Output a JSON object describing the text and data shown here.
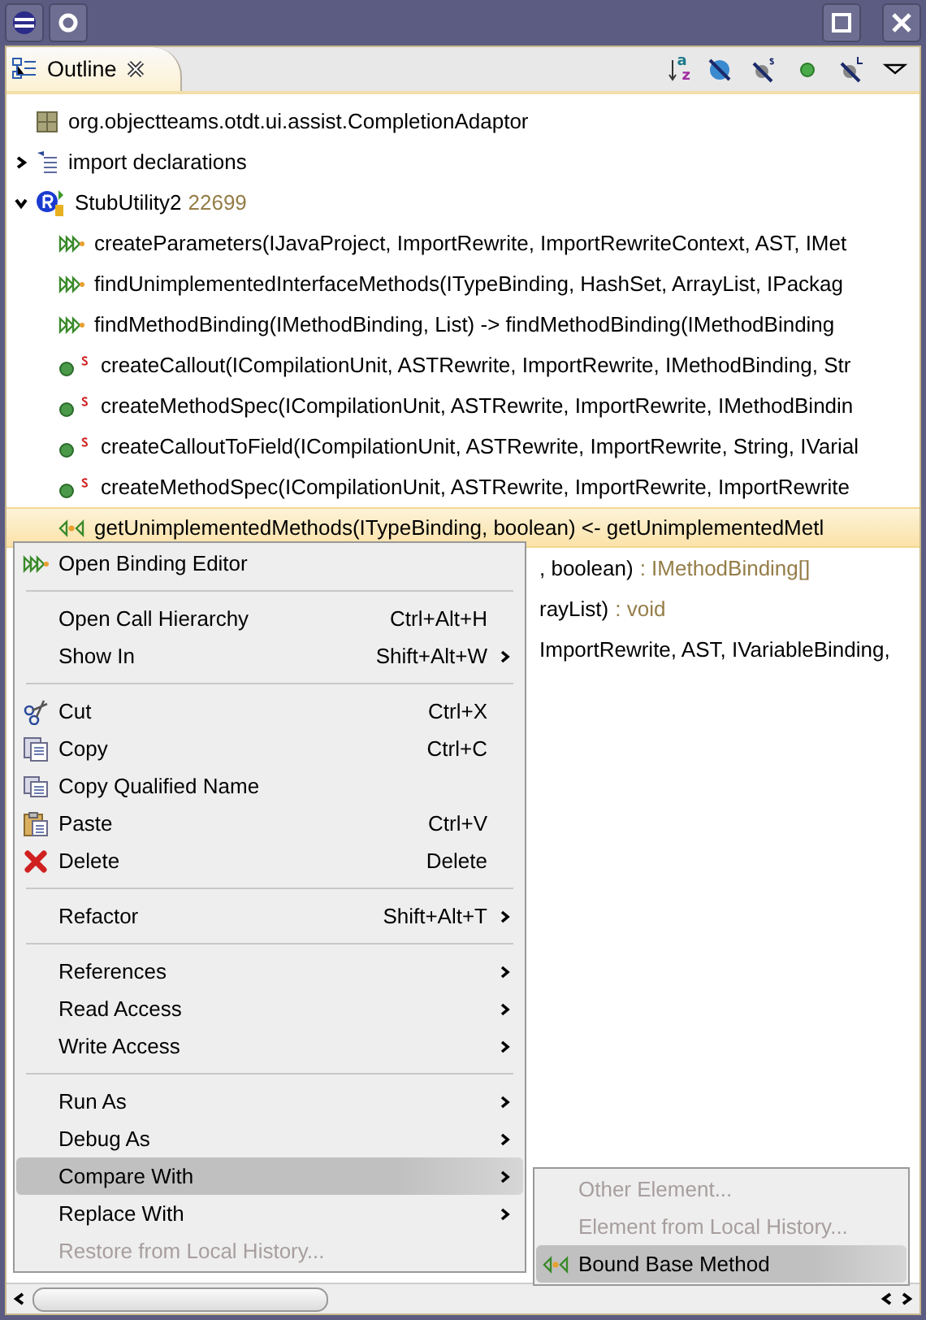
{
  "view_tab": {
    "label": "Outline",
    "selected": true
  },
  "toolbar": [
    {
      "kind": "sort",
      "top_letter": "a",
      "bottom_letter": "z"
    },
    {
      "kind": "hide-fields"
    },
    {
      "kind": "hide-static"
    },
    {
      "kind": "hide-nonpublic"
    },
    {
      "kind": "hide-local"
    },
    {
      "kind": "menu"
    }
  ],
  "tree": [
    {
      "kind": "package",
      "label": "org.objectteams.otdt.ui.assist.CompletionAdaptor",
      "selected": false
    },
    {
      "kind": "imports",
      "label": "import declarations",
      "expanded": false,
      "selected": false
    },
    {
      "kind": "role",
      "label": "StubUtility2",
      "suffix": "22699",
      "expanded": true,
      "selected": false,
      "children": [
        {
          "kind": "callin",
          "label": "createParameters(IJavaProject, ImportRewrite, ImportRewriteContext, AST, IMet",
          "selected": false
        },
        {
          "kind": "callin",
          "label": "findUnimplementedInterfaceMethods(ITypeBinding, HashSet, ArrayList, IPackag",
          "selected": false
        },
        {
          "kind": "callin",
          "label": "findMethodBinding(IMethodBinding, List) -> findMethodBinding(IMethodBinding",
          "selected": false
        },
        {
          "kind": "static-method",
          "label": "createCallout(ICompilationUnit, ASTRewrite, ImportRewrite, IMethodBinding, Str",
          "selected": false
        },
        {
          "kind": "static-method",
          "label": "createMethodSpec(ICompilationUnit, ASTRewrite, ImportRewrite, IMethodBindin",
          "selected": false
        },
        {
          "kind": "static-method",
          "label": "createCalloutToField(ICompilationUnit, ASTRewrite, ImportRewrite, String, IVarial",
          "selected": false
        },
        {
          "kind": "static-method",
          "label": "createMethodSpec(ICompilationUnit, ASTRewrite, ImportRewrite, ImportRewrite",
          "selected": false
        },
        {
          "kind": "callout",
          "label": "getUnimplementedMethods(ITypeBinding, boolean) <- getUnimplementedMetl",
          "selected": true
        },
        {
          "kind": "partial",
          "label": ", boolean)",
          "suffix": ": IMethodBinding[]",
          "selected": false
        },
        {
          "kind": "partial",
          "label": "rayList)",
          "suffix": ": void",
          "selected": false
        },
        {
          "kind": "partial",
          "label": "ImportRewrite, AST, IVariableBinding,",
          "selected": false
        }
      ]
    }
  ],
  "context_menu": [
    {
      "kind": "binding",
      "label": "Open Binding Editor",
      "disabled": false,
      "selected": false,
      "submenu": false
    },
    {
      "kind": "separator"
    },
    {
      "kind": "item",
      "label": "Open Call Hierarchy",
      "shortcut": "Ctrl+Alt+H",
      "disabled": false,
      "selected": false,
      "submenu": false
    },
    {
      "kind": "item",
      "label": "Show In",
      "shortcut": "Shift+Alt+W",
      "disabled": false,
      "selected": false,
      "submenu": true
    },
    {
      "kind": "separator"
    },
    {
      "kind": "cut",
      "label": "Cut",
      "shortcut": "Ctrl+X",
      "disabled": false,
      "selected": false,
      "submenu": false
    },
    {
      "kind": "copy",
      "label": "Copy",
      "shortcut": "Ctrl+C",
      "disabled": false,
      "selected": false,
      "submenu": false
    },
    {
      "kind": "copy-qualified",
      "label": "Copy Qualified Name",
      "disabled": false,
      "selected": false,
      "submenu": false
    },
    {
      "kind": "paste",
      "label": "Paste",
      "shortcut": "Ctrl+V",
      "disabled": false,
      "selected": false,
      "submenu": false
    },
    {
      "kind": "delete",
      "label": "Delete",
      "shortcut": "Delete",
      "disabled": false,
      "selected": false,
      "submenu": false
    },
    {
      "kind": "separator"
    },
    {
      "kind": "item",
      "label": "Refactor",
      "shortcut": "Shift+Alt+T",
      "disabled": false,
      "selected": false,
      "submenu": true
    },
    {
      "kind": "separator"
    },
    {
      "kind": "item",
      "label": "References",
      "disabled": false,
      "selected": false,
      "submenu": true
    },
    {
      "kind": "item",
      "label": "Read Access",
      "disabled": false,
      "selected": false,
      "submenu": true
    },
    {
      "kind": "item",
      "label": "Write Access",
      "disabled": false,
      "selected": false,
      "submenu": true
    },
    {
      "kind": "separator"
    },
    {
      "kind": "item",
      "label": "Run As",
      "disabled": false,
      "selected": false,
      "submenu": true
    },
    {
      "kind": "item",
      "label": "Debug As",
      "disabled": false,
      "selected": false,
      "submenu": true
    },
    {
      "kind": "item",
      "label": "Compare With",
      "disabled": false,
      "selected": true,
      "submenu": true
    },
    {
      "kind": "item",
      "label": "Replace With",
      "disabled": false,
      "selected": false,
      "submenu": true
    },
    {
      "kind": "item",
      "label": "Restore from Local History...",
      "disabled": true,
      "selected": false,
      "submenu": false
    }
  ],
  "submenu": [
    {
      "kind": "item",
      "label": "Other Element...",
      "disabled": true,
      "selected": false
    },
    {
      "kind": "item",
      "label": "Element from Local History...",
      "disabled": true,
      "selected": false
    },
    {
      "kind": "callout",
      "label": "Bound Base Method",
      "disabled": false,
      "selected": true
    }
  ]
}
